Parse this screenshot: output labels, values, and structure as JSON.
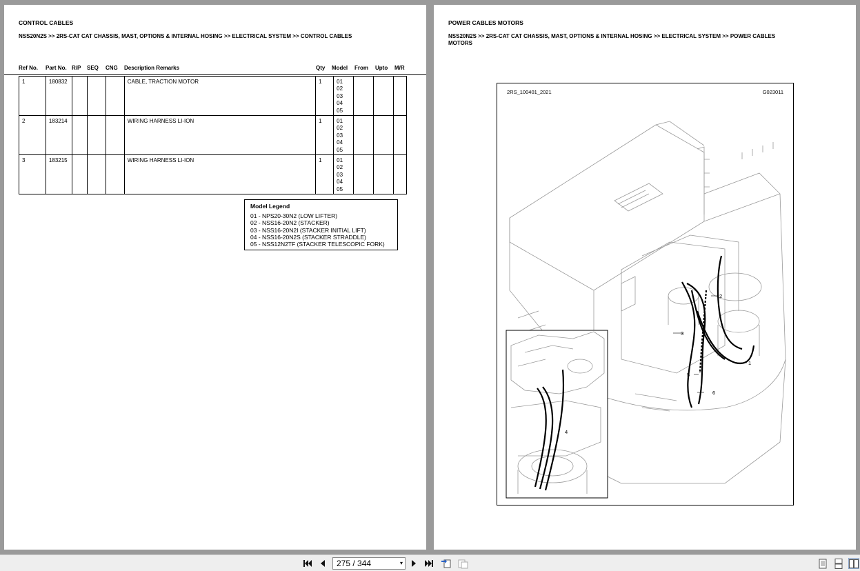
{
  "left_page": {
    "title": "CONTROL CABLES",
    "breadcrumb": "NSS20N2S >> 2RS-CAT CAT CHASSIS, MAST, OPTIONS & INTERNAL HOSING >> ELECTRICAL SYSTEM >> CONTROL CABLES",
    "columns": [
      "Ref No.",
      "Part No.",
      "R/P",
      "SEQ",
      "CNG",
      "Description Remarks",
      "Qty",
      "Model",
      "From",
      "Upto",
      "M/R"
    ],
    "rows": [
      {
        "ref": "1",
        "part": "180832",
        "desc": "CABLE, TRACTION MOTOR",
        "qty": "1",
        "models": [
          "01",
          "02",
          "03",
          "04",
          "05"
        ]
      },
      {
        "ref": "2",
        "part": "183214",
        "desc": "WIRING HARNESS LI-ION",
        "qty": "1",
        "models": [
          "01",
          "02",
          "03",
          "04",
          "05"
        ]
      },
      {
        "ref": "3",
        "part": "183215",
        "desc": "WIRING HARNESS LI-ION",
        "qty": "1",
        "models": [
          "01",
          "02",
          "03",
          "04",
          "05"
        ]
      }
    ],
    "legend": {
      "title": "Model Legend",
      "items": [
        "01 - NPS20-30N2 (LOW LIFTER)",
        "02 - NSS16-20N2 (STACKER)",
        "03 - NSS16-20N2I (STACKER INITIAL LIFT)",
        "04 - NSS16-20N2S (STACKER STRADDLE)",
        "05 - NSS12N2TF (STACKER TELESCOPIC FORK)"
      ]
    }
  },
  "right_page": {
    "title": "POWER CABLES MOTORS",
    "breadcrumb_line1": "NSS20N2S >> 2RS-CAT CAT CHASSIS, MAST, OPTIONS & INTERNAL HOSING >> ELECTRICAL SYSTEM >> POWER CABLES",
    "breadcrumb_line2": "MOTORS",
    "figure_left_label": "2RS_100401_2021",
    "figure_right_label": "G023011",
    "callouts": [
      "1",
      "2",
      "3",
      "4",
      "5",
      "6"
    ]
  },
  "toolbar": {
    "page_display": "275 / 344",
    "icons": [
      "first-page-icon",
      "prev-page-icon",
      "next-page-icon",
      "last-page-icon",
      "prev-view-icon",
      "next-view-icon",
      "single-page-icon",
      "continuous-icon",
      "two-page-icon"
    ]
  }
}
